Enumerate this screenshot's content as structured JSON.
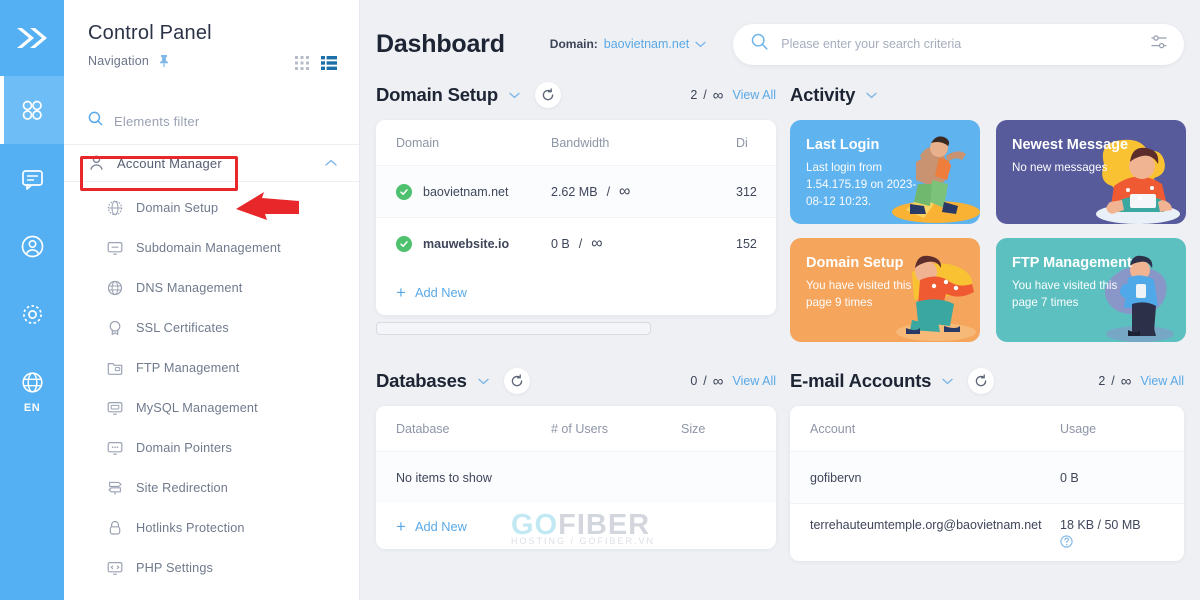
{
  "rail": {
    "logo_icon": "double-chevron-right-icon",
    "items": [
      {
        "icon": "dashboard-grid-icon",
        "name": "dashboard",
        "active": true
      },
      {
        "icon": "message-icon",
        "name": "messages",
        "active": false
      },
      {
        "icon": "user-circle-icon",
        "name": "account",
        "active": false
      },
      {
        "icon": "gear-icon",
        "name": "settings",
        "active": false
      },
      {
        "icon": "globe-icon",
        "name": "language",
        "active": false
      }
    ],
    "language_label": "EN"
  },
  "nav": {
    "title": "Control Panel",
    "subtitle": "Navigation",
    "pin_icon": "pin-icon",
    "grid_view_icon": "grid-view-icon",
    "list_view_icon": "list-view-icon",
    "filter_placeholder": "Elements filter",
    "filter_icon": "search-icon",
    "group": {
      "label": "Account Manager",
      "icon": "user-icon",
      "expanded": true,
      "chevron_icon": "chevron-up-icon"
    },
    "items": [
      {
        "label": "Domain Setup",
        "icon": "globe-dashed-icon"
      },
      {
        "label": "Subdomain Management",
        "icon": "monitor-icon"
      },
      {
        "label": "DNS Management",
        "icon": "globe-icon"
      },
      {
        "label": "SSL Certificates",
        "icon": "certificate-icon"
      },
      {
        "label": "FTP Management",
        "icon": "folder-icon"
      },
      {
        "label": "MySQL Management",
        "icon": "database-monitor-icon"
      },
      {
        "label": "Domain Pointers",
        "icon": "monitor-icon"
      },
      {
        "label": "Site Redirection",
        "icon": "signpost-icon"
      },
      {
        "label": "Hotlinks Protection",
        "icon": "lock-icon"
      },
      {
        "label": "PHP Settings",
        "icon": "monitor-code-icon"
      }
    ]
  },
  "header": {
    "page_title": "Dashboard",
    "domain_label": "Domain:",
    "domain_value": "baovietnam.net",
    "domain_chevron_icon": "chevron-down-icon",
    "search_icon": "search-icon",
    "search_placeholder": "Please enter your search criteria",
    "search_value": "",
    "filter_icon": "sliders-icon"
  },
  "sections": {
    "domain_setup": {
      "title": "Domain Setup",
      "chevron_icon": "chevron-down-icon",
      "refresh_icon": "refresh-icon",
      "count": "2",
      "separator": "/",
      "limit": "∞",
      "view_all": "View All",
      "columns": [
        "Domain",
        "Bandwidth",
        "Di"
      ],
      "rows": [
        {
          "status_icon": "check-circle-icon",
          "domain": "baovietnam.net",
          "bandwidth_used": "2.62 MB",
          "bandwidth_sep": "/",
          "bandwidth_limit": "∞",
          "disk": "312"
        },
        {
          "status_icon": "check-circle-icon",
          "domain": "mauwebsite.io",
          "bandwidth_used": "0 B",
          "bandwidth_sep": "/",
          "bandwidth_limit": "∞",
          "disk": "152"
        }
      ],
      "add_new": "Add New",
      "add_icon": "plus-icon"
    },
    "activity": {
      "title": "Activity",
      "chevron_icon": "chevron-down-icon",
      "tiles": [
        {
          "title": "Last Login",
          "subtitle": "Last login from 1.54.175.19 on 2023-08-12 10:23.",
          "color": "#5fb3ef",
          "art": "person-running-art"
        },
        {
          "title": "Newest Message",
          "subtitle": "No new messages",
          "color": "#575a9b",
          "art": "person-laptop-art"
        },
        {
          "title": "Domain Setup",
          "subtitle": "You have visited this page 9 times",
          "color": "#f5a55c",
          "art": "person-crouching-art"
        },
        {
          "title": "FTP Management",
          "subtitle": "You have visited this page 7 times",
          "color": "#5cc0c0",
          "art": "person-phone-art"
        }
      ]
    },
    "databases": {
      "title": "Databases",
      "chevron_icon": "chevron-down-icon",
      "refresh_icon": "refresh-icon",
      "count": "0",
      "separator": "/",
      "limit": "∞",
      "view_all": "View All",
      "columns": [
        "Database",
        "# of Users",
        "Size"
      ],
      "empty_text": "No items to show",
      "add_new": "Add New",
      "add_icon": "plus-icon"
    },
    "email_accounts": {
      "title": "E-mail Accounts",
      "chevron_icon": "chevron-down-icon",
      "refresh_icon": "refresh-icon",
      "count": "2",
      "separator": "/",
      "limit": "∞",
      "view_all": "View All",
      "columns": [
        "Account",
        "Usage"
      ],
      "rows": [
        {
          "account": "gofibervn",
          "usage": "0 B",
          "help_icon": ""
        },
        {
          "account": "terrehauteumtemple.org@baovietnam.net",
          "usage": "18 KB / 50 MB",
          "help_icon": "help-circle-icon"
        }
      ]
    }
  },
  "watermark": {
    "brand_a": "GO",
    "brand_b": "FIBER",
    "tagline": "HOSTING / GOFIBER.VN"
  },
  "annotations": {
    "highlight_box_target": "Account Manager",
    "arrow_target": "Domain Setup",
    "color": "#e8272b"
  },
  "colors": {
    "rail_blue": "#54b0f2",
    "accent_blue": "#5aa9e6",
    "background": "#eef0f4",
    "status_green": "#4ec16f",
    "annotation_red": "#e8272b"
  }
}
